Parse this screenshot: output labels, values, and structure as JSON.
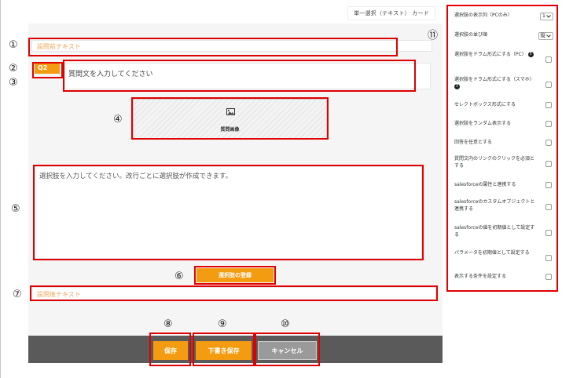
{
  "question_type": "単一選択（テキスト） カード",
  "markers": [
    "①",
    "②",
    "③",
    "④",
    "⑤",
    "⑥",
    "⑦",
    "⑧",
    "⑨",
    "⑩",
    "⑪"
  ],
  "pre_text_placeholder": "設問前テキスト",
  "question_badge": "Q2",
  "question_text_placeholder": "質問文を入力してください",
  "image_label": "質問画像",
  "choices_placeholder": "選択肢を入力してください。改行ごとに選択肢が作成できます。",
  "register_button": "選択肢の登録",
  "post_text_placeholder": "設問後テキスト",
  "save_button": "保存",
  "draft_button": "下書き保存",
  "cancel_button": "キャンセル",
  "settings": {
    "columns_label": "選択肢の表示列（PCのみ）",
    "columns_value": "1",
    "order_label": "選択肢の並び順",
    "order_value": "縦",
    "items": [
      "選択肢をドラム形式にする（PC）",
      "選択肢をドラム形式にする（スマホ）",
      "セレクトボックス形式にする",
      "選択肢をランダム表示する",
      "回答を任意とする",
      "質問文内のリンクのクリックを必須とする",
      "salesforceの属性と連携する",
      "salesforceのカスタムオブジェクトと連携する",
      "salesforceの値を初期値として設定する",
      "パラメータを初期値として設定する",
      "表示する条件を設定する"
    ],
    "help_glyph": "?"
  }
}
